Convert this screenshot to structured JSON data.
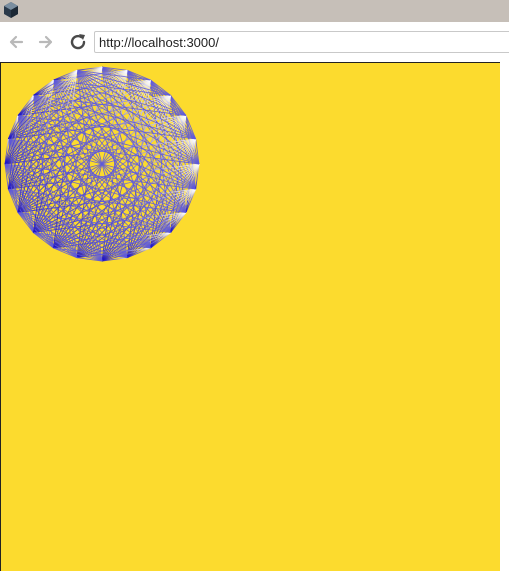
{
  "browser": {
    "app_icon": "app-cube-icon",
    "back_icon": "arrow-left-icon",
    "forward_icon": "arrow-right-icon",
    "reload_icon": "reload-icon",
    "address_value": "http://localhost:3000/"
  },
  "page": {
    "background_color": "#fcdb2e",
    "figure": {
      "type": "string-art rosette",
      "points": 24,
      "line_colors": [
        "#1a12c8",
        "#6a66e0",
        "#ffffff"
      ]
    }
  }
}
